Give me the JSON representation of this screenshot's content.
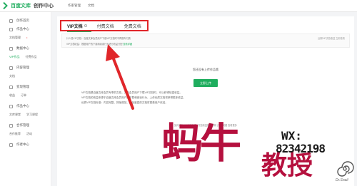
{
  "topbar": {
    "brand": "百度文库",
    "brand_sub": "创作中心",
    "nav": [
      "作家管理",
      "文档"
    ]
  },
  "sidebar": {
    "items": [
      {
        "label": "创作首页"
      },
      {
        "label": "作品中心"
      },
      {
        "label": "数据中心"
      },
      {
        "label": "内容管理"
      },
      {
        "label": "变现管理"
      },
      {
        "label": "作品中心"
      },
      {
        "label": "合作管理"
      },
      {
        "label": "作者中心"
      }
    ],
    "subs": [
      {
        "a": "文档管理",
        "b": ""
      },
      {
        "a": "VIP作品",
        "b": "付费作品"
      },
      {
        "a": "文档"
      },
      {
        "a": "收益",
        "b": "订单"
      },
      {
        "a": "文库课堂",
        "b": "学习课程"
      },
      {
        "a": "数据分析",
        "b": "运营数据"
      },
      {
        "a": "合作推荐",
        "b": "活动"
      }
    ]
  },
  "tabs": [
    {
      "label": "VIP文档",
      "active": true
    },
    {
      "label": "付费文档",
      "active": false
    },
    {
      "label": "免费文档",
      "active": false
    }
  ],
  "notice": {
    "line1": "什么是VIP文档：百度文库会员用户下载VIP文档时不再额外付费",
    "line2": "VIP文档收益：根据用户的下载和阅读行为进行收益分配",
    "link": "查看详细",
    "right": "近期VIP文档收益 立即查看"
  },
  "empty": {
    "text": "您还没有上传作品哦",
    "button": "立即上传"
  },
  "desc": {
    "p1": "VIP文档是百度文库会员专享的文档，文库会员用户下载VIP文档时，可以获得较高收益。",
    "p2": "VIP文档的收益来源于百度文库会员用户的下载和阅读行为，上传优质文档将获得更多收益。",
    "p3": "优质VIP文档标准：内容完整、排版规范、原创度高的文档将更受用户欢迎。"
  },
  "footer": {
    "text": "如何成为VIP文档作者 | 文档收益规则说明 | 常见问题 查看更多"
  },
  "watermark": {
    "chars": "蚂牛",
    "sub": "教授",
    "wx": "WX:",
    "number": "82342198",
    "small": "Dr.Snail"
  },
  "colors": {
    "accent": "#1fad5e",
    "highlight_border": "#e0262a",
    "watermark": "#b5103e"
  }
}
